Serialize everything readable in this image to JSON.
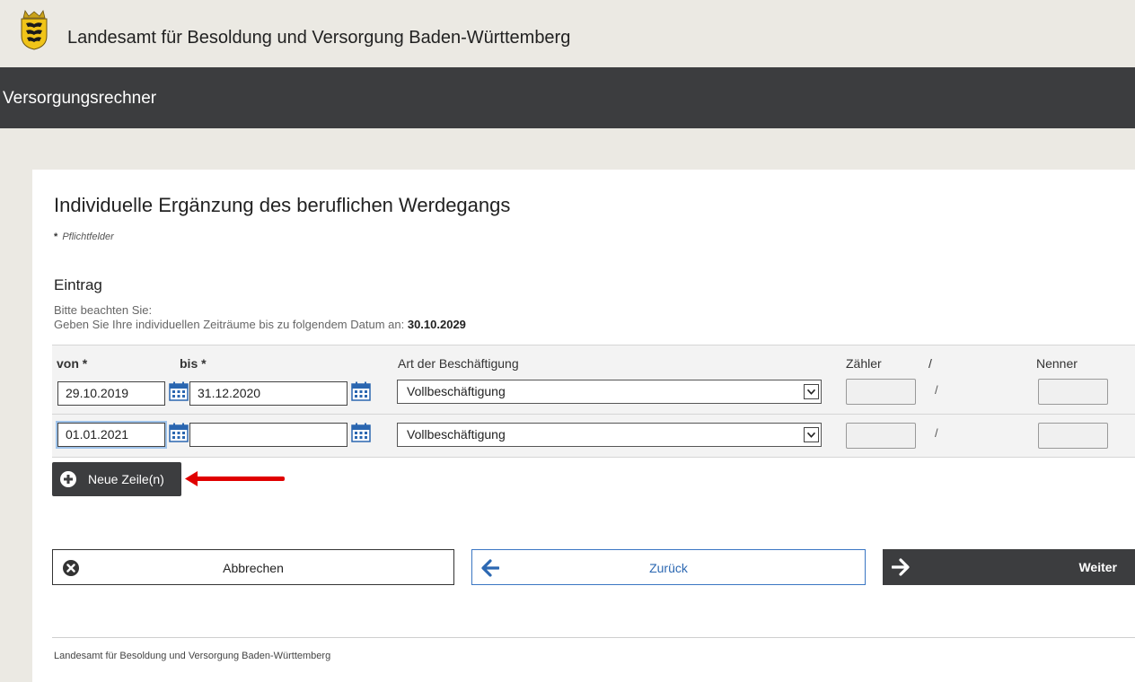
{
  "header": {
    "org_title": "Landesamt für Besoldung und Versorgung Baden-Württemberg",
    "app_title": "Versorgungsrechner"
  },
  "main": {
    "title": "Individuelle Ergänzung des beruflichen Werdegangs",
    "required_marker": "*",
    "required_note": "Pflichtfelder",
    "section_title": "Eintrag",
    "hint_line1": "Bitte beachten Sie:",
    "hint_line2_prefix": "Geben Sie Ihre individuellen Zeiträume bis zu folgendem Datum an:",
    "hint_date": "30.10.2029"
  },
  "table": {
    "headers": {
      "from": "von *",
      "to": "bis *",
      "type": "Art der Beschäftigung",
      "numerator": "Zähler",
      "slash": "/",
      "denominator": "Nenner"
    },
    "rows": [
      {
        "from": "29.10.2019",
        "to": "31.12.2020",
        "type": "Vollbeschäftigung",
        "numerator": "",
        "slash": "/",
        "denominator": ""
      },
      {
        "from": "01.01.2021",
        "to": "",
        "type": "Vollbeschäftigung",
        "numerator": "",
        "slash": "/",
        "denominator": ""
      }
    ]
  },
  "actions": {
    "add_row_label": "Neue Zeile(n)",
    "cancel_label": "Abbrechen",
    "back_label": "Zurück",
    "next_label": "Weiter"
  },
  "footer": {
    "text": "Landesamt für Besoldung und Versorgung Baden-Württemberg"
  },
  "icons": {
    "logo": "coat-of-arms-icon",
    "calendar": "calendar-icon",
    "plus": "plus-circle-icon",
    "cancel": "close-circle-icon",
    "back": "arrow-left-icon",
    "next": "arrow-right-icon",
    "annotation": "red-arrow-icon"
  },
  "colors": {
    "dark_bar": "#3c3d3f",
    "page_bg": "#ebe9e3",
    "link_blue": "#2c68b2",
    "annotation_red": "#e00000",
    "calendar_blue": "#2a66b0"
  }
}
